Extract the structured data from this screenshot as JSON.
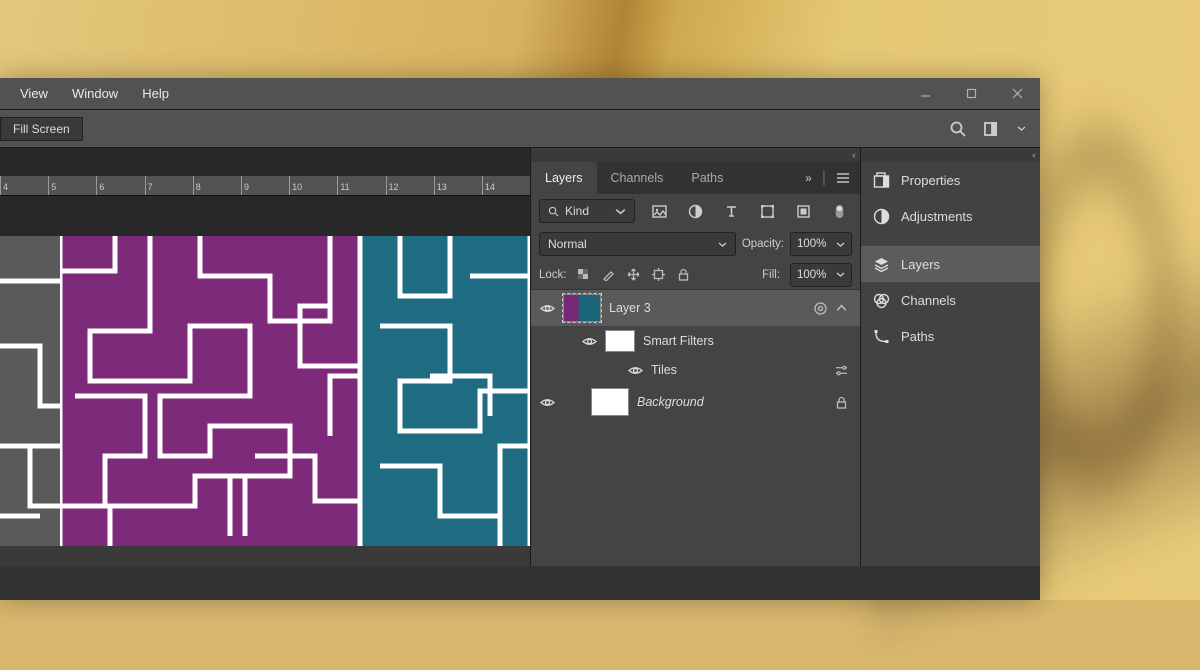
{
  "menubar": {
    "view": "View",
    "window": "Window",
    "help": "Help"
  },
  "optbar": {
    "fill_screen": "Fill Screen"
  },
  "ruler": [
    "4",
    "5",
    "6",
    "7",
    "8",
    "9",
    "10",
    "11",
    "12",
    "13",
    "14"
  ],
  "panel_tabs": {
    "layers": "Layers",
    "channels": "Channels",
    "paths": "Paths"
  },
  "layers_panel": {
    "filter_kind": "Kind",
    "blend_mode": "Normal",
    "opacity_label": "Opacity:",
    "opacity_value": "100%",
    "lock_label": "Lock:",
    "fill_label": "Fill:",
    "fill_value": "100%"
  },
  "layers": {
    "layer3": "Layer 3",
    "smart_filters": "Smart Filters",
    "tiles": "Tiles",
    "background": "Background"
  },
  "side_panel": {
    "properties": "Properties",
    "adjustments": "Adjustments",
    "layers": "Layers",
    "channels": "Channels",
    "paths": "Paths"
  }
}
